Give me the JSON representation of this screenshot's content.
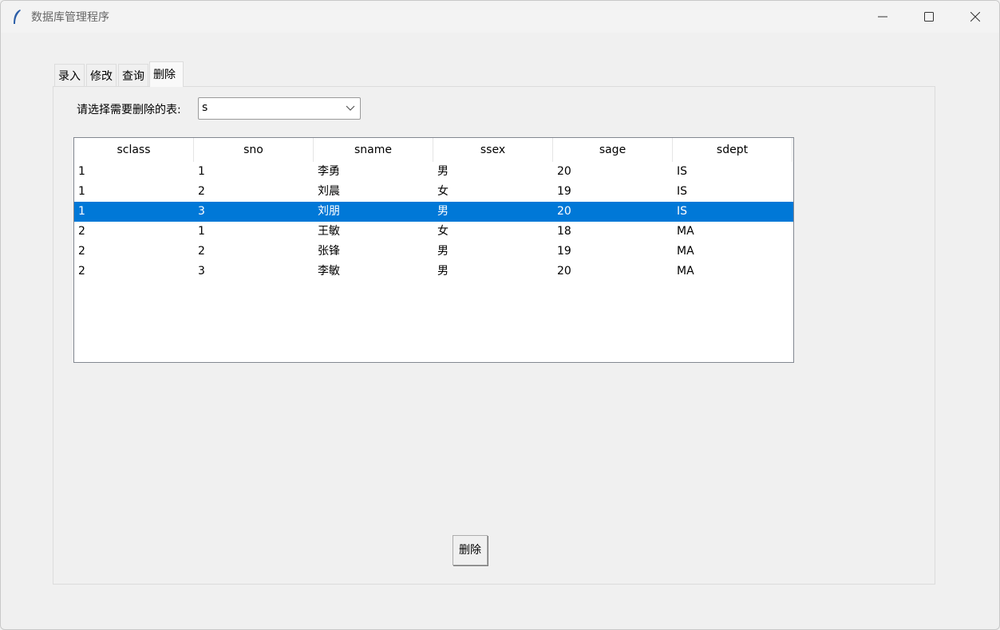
{
  "window": {
    "title": "数据库管理程序"
  },
  "tabs": [
    {
      "label": "录入"
    },
    {
      "label": "修改"
    },
    {
      "label": "查询"
    },
    {
      "label": "删除",
      "active": true
    }
  ],
  "delete_tab": {
    "table_label": "请选择需要删除的表:",
    "table_select": {
      "value": "s"
    },
    "columns": [
      "sclass",
      "sno",
      "sname",
      "ssex",
      "sage",
      "sdept"
    ],
    "rows": [
      [
        "1",
        "1",
        "李勇",
        "男",
        "20",
        "IS"
      ],
      [
        "1",
        "2",
        "刘晨",
        "女",
        "19",
        "IS"
      ],
      [
        "1",
        "3",
        "刘朋",
        "男",
        "20",
        "IS"
      ],
      [
        "2",
        "1",
        "王敏",
        "女",
        "18",
        "MA"
      ],
      [
        "2",
        "2",
        "张锋",
        "男",
        "19",
        "MA"
      ],
      [
        "2",
        "3",
        "李敏",
        "男",
        "20",
        "MA"
      ]
    ],
    "selected_row_index": 2,
    "delete_button": "删除"
  },
  "colors": {
    "selection": "#0078d7"
  }
}
